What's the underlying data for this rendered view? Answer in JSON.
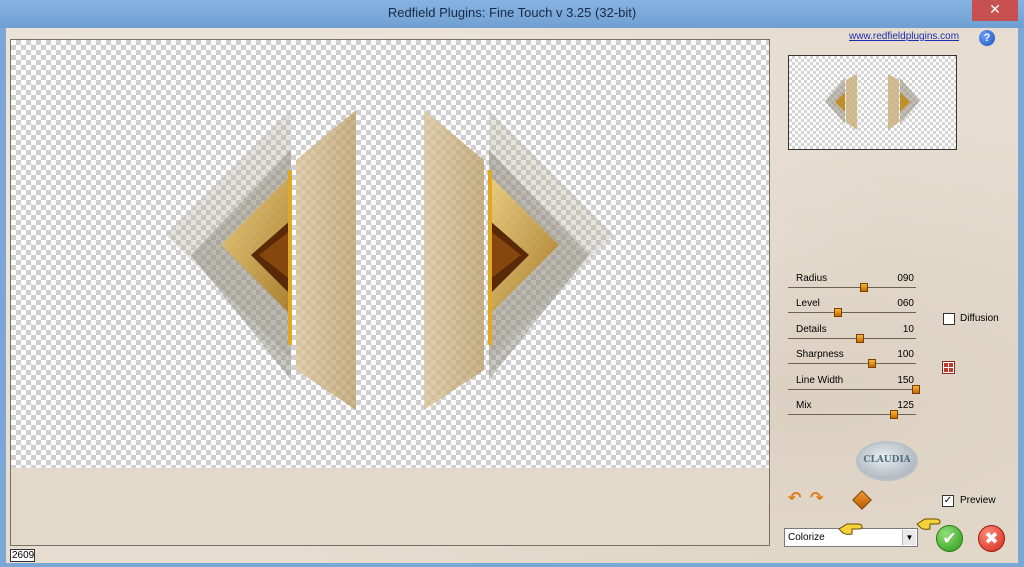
{
  "window": {
    "title": "Redfield Plugins: Fine Touch v 3.25 (32-bit)",
    "close_glyph": "✕"
  },
  "header": {
    "link_text": "www.redfieldplugins.com",
    "help_glyph": "?"
  },
  "sliders": [
    {
      "label": "Radius",
      "value": "090",
      "level": 0.59
    },
    {
      "label": "Level",
      "value": "060",
      "level": 0.39
    },
    {
      "label": "Details",
      "value": "10",
      "level": 0.56
    },
    {
      "label": "Sharpness",
      "value": "100",
      "level": 0.66
    },
    {
      "label": "Line Width",
      "value": "150",
      "level": 1.0
    },
    {
      "label": "Mix",
      "value": "125",
      "level": 0.83
    }
  ],
  "options": {
    "diffusion": {
      "label": "Diffusion",
      "checked": false
    },
    "preview": {
      "label": "Preview",
      "checked": true
    }
  },
  "mode_select": {
    "value": "Colorize"
  },
  "logo_text": "CLAUDIA",
  "status": {
    "value": "2609"
  },
  "colors": {
    "accent": "#e07a12",
    "ok": "#2f9a16",
    "cancel": "#d02a18"
  }
}
